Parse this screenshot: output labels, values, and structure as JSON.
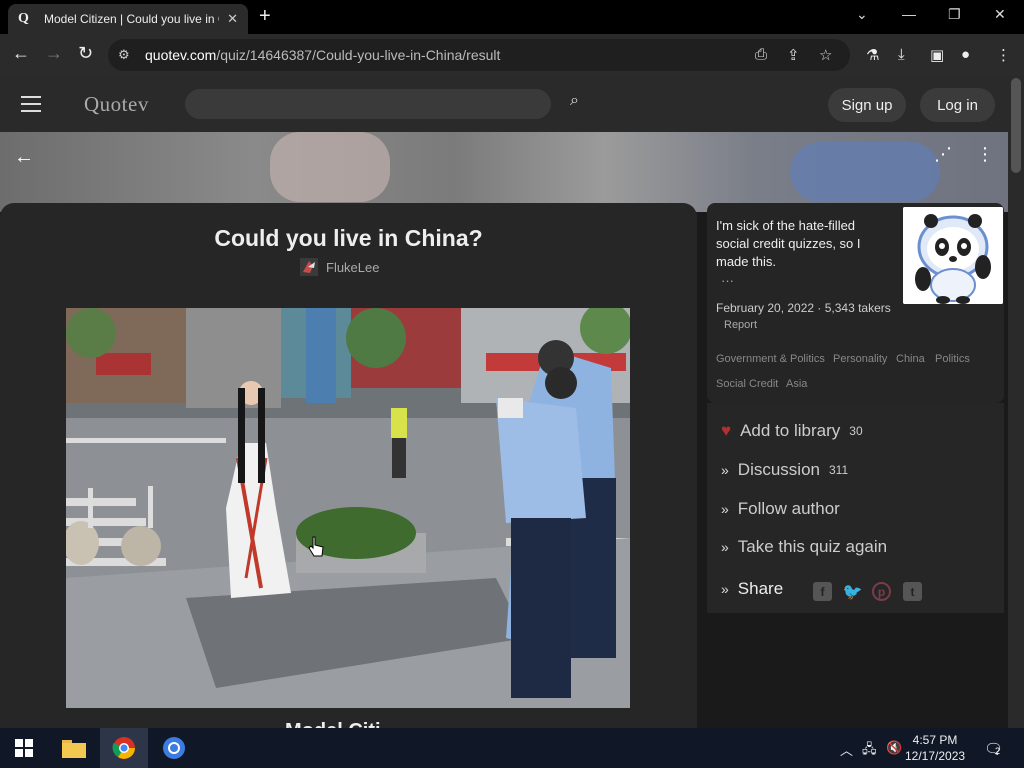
{
  "browser": {
    "tab_title": "Model Citizen | Could you live in China?",
    "tab_favicon": "Q",
    "url_domain": "quotev.com",
    "url_path": "/quiz/14646387/Could-you-live-in-China/result"
  },
  "site": {
    "logo": "Quotev",
    "search_placeholder": "",
    "signup_label": "Sign up",
    "login_label": "Log in"
  },
  "quiz": {
    "title": "Could you live in China?",
    "author": "FlukeLee",
    "result_title_partial": "Model Citi..."
  },
  "side": {
    "description": "I'm sick of the hate-filled social credit quizzes, so I made this.",
    "more": "···",
    "meta": "February 20, 2022 · 5,343 takers",
    "report": "Report",
    "tags": [
      "Government & Politics",
      "Personality",
      "China",
      "Politics",
      "Social Credit",
      "Asia"
    ]
  },
  "actions": {
    "add_library": "Add to library",
    "add_library_count": "30",
    "discussion": "Discussion",
    "discussion_count": "311",
    "follow": "Follow author",
    "retake": "Take this quiz again",
    "share": "Share"
  },
  "taskbar": {
    "time": "4:57 PM",
    "date": "12/17/2023",
    "notif_count": "2"
  },
  "colors": {
    "accent_red": "#c0392b",
    "panel_bg": "#262626"
  }
}
